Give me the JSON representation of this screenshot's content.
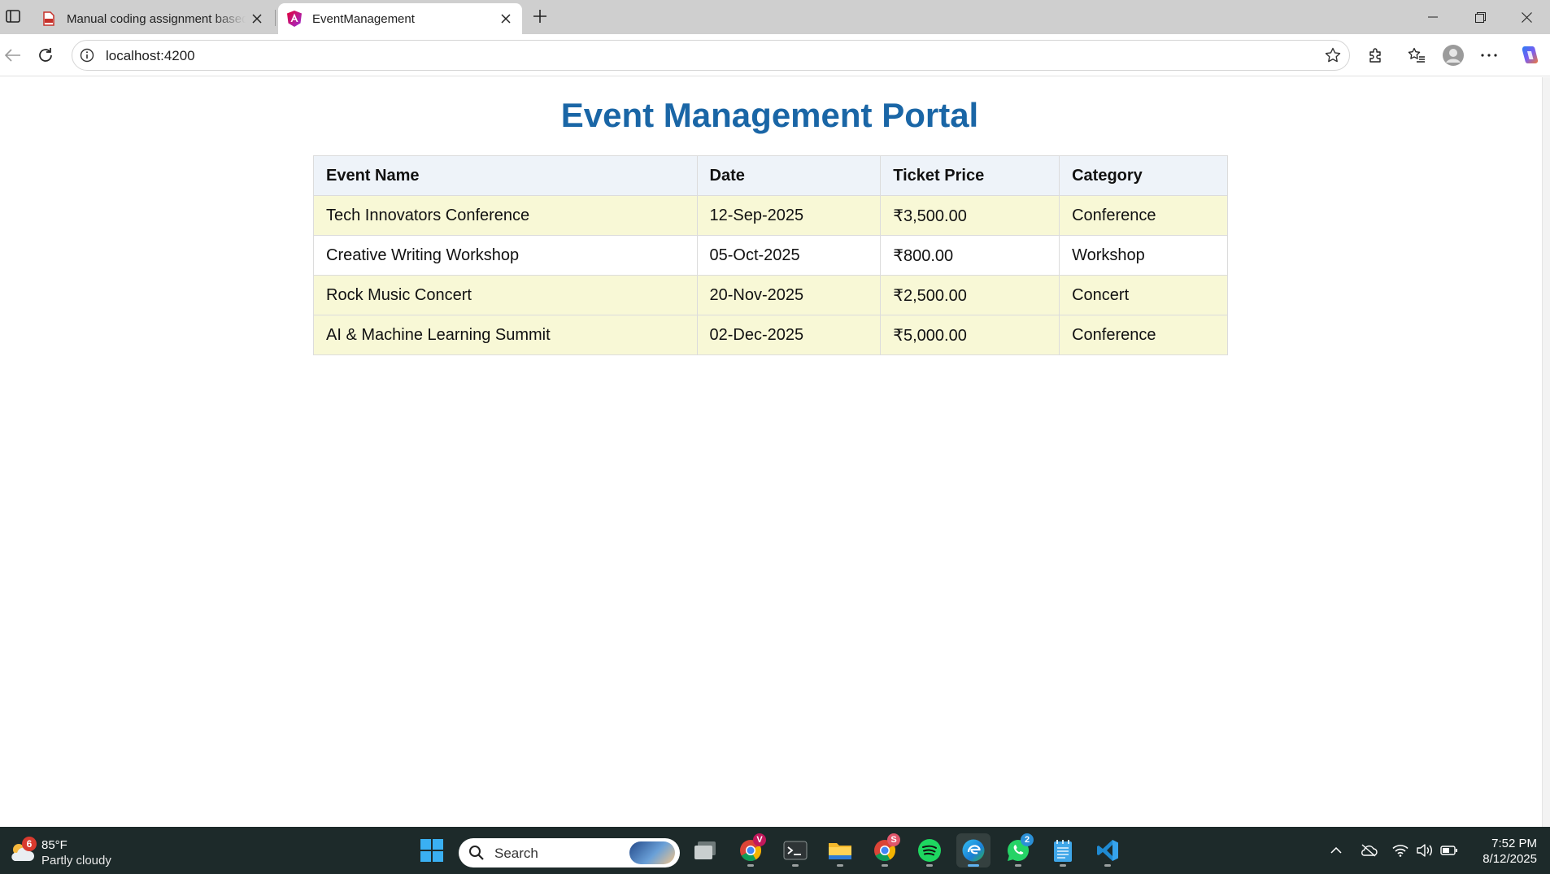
{
  "browser": {
    "tabs": [
      {
        "title": "Manual coding assignment based on Angular",
        "active": false
      },
      {
        "title": "EventManagement",
        "active": true
      }
    ],
    "address": {
      "url": "localhost:4200"
    }
  },
  "page": {
    "title": "Event Management Portal",
    "table": {
      "headers": [
        "Event Name",
        "Date",
        "Ticket Price",
        "Category"
      ],
      "rows": [
        [
          "Tech Innovators Conference",
          "12-Sep-2025",
          "₹3,500.00",
          "Conference"
        ],
        [
          "Creative Writing Workshop",
          "05-Oct-2025",
          "₹800.00",
          "Workshop"
        ],
        [
          "Rock Music Concert",
          "20-Nov-2025",
          "₹2,500.00",
          "Concert"
        ],
        [
          "AI & Machine Learning Summit",
          "02-Dec-2025",
          "₹5,000.00",
          "Conference"
        ]
      ]
    }
  },
  "taskbar": {
    "weather": {
      "badge": "6",
      "temp": "85°F",
      "condition": "Partly cloudy"
    },
    "search_label": "Search",
    "apps": [
      {
        "name": "task-view",
        "badge": ""
      },
      {
        "name": "chrome",
        "badge": "V"
      },
      {
        "name": "terminal",
        "badge": ""
      },
      {
        "name": "file-explorer",
        "badge": ""
      },
      {
        "name": "chrome-profile",
        "badge": "S"
      },
      {
        "name": "spotify",
        "badge": ""
      },
      {
        "name": "edge",
        "badge": ""
      },
      {
        "name": "whatsapp",
        "badge": "2"
      },
      {
        "name": "notepad",
        "badge": ""
      },
      {
        "name": "vscode",
        "badge": ""
      }
    ],
    "clock": {
      "time": "7:52 PM",
      "date": "8/12/2025"
    }
  },
  "colors": {
    "title": "#1a66a6",
    "header_bg": "#eef3f9",
    "row_highlight": "#f8f8d6",
    "taskbar_bg": "#1d2a2a"
  }
}
